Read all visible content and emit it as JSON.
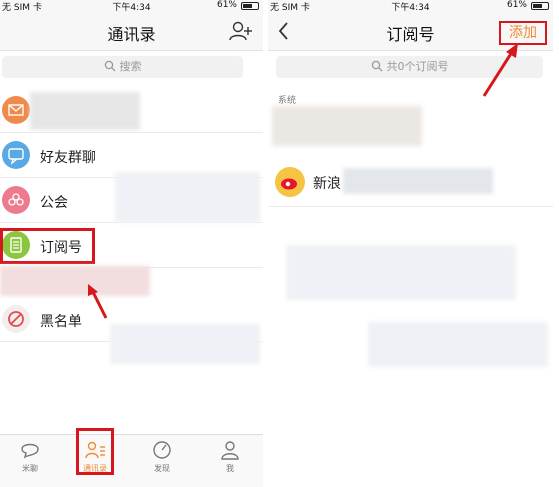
{
  "left": {
    "status": {
      "carrier": "无 SIM 卡",
      "time": "下午4:34",
      "battery": "61%"
    },
    "nav": {
      "title": "通讯录"
    },
    "search": {
      "placeholder": "搜索"
    },
    "rows": [
      {
        "label": "",
        "icon": "mail-icon"
      },
      {
        "label": "好友群聊",
        "icon": "chat-group-icon"
      },
      {
        "label": "公会",
        "icon": "guild-icon"
      },
      {
        "label": "订阅号",
        "icon": "subscription-icon"
      },
      {
        "label": "黑名单",
        "icon": "blacklist-icon"
      }
    ],
    "tabs": [
      {
        "label": "米聊",
        "icon": "chat-bubble-icon"
      },
      {
        "label": "通讯录",
        "icon": "contacts-icon"
      },
      {
        "label": "发现",
        "icon": "discover-icon"
      },
      {
        "label": "我",
        "icon": "profile-icon"
      }
    ],
    "accent": "#f08a35",
    "highlight": "#d4181e"
  },
  "right": {
    "status": {
      "carrier": "无 SIM 卡",
      "time": "下午4:34",
      "battery": "61%"
    },
    "nav": {
      "title": "订阅号",
      "add": "添加"
    },
    "search": {
      "placeholder": "共0个订阅号"
    },
    "section": "系统",
    "weibo": {
      "label": "新浪",
      "icon": "weibo-icon"
    }
  }
}
